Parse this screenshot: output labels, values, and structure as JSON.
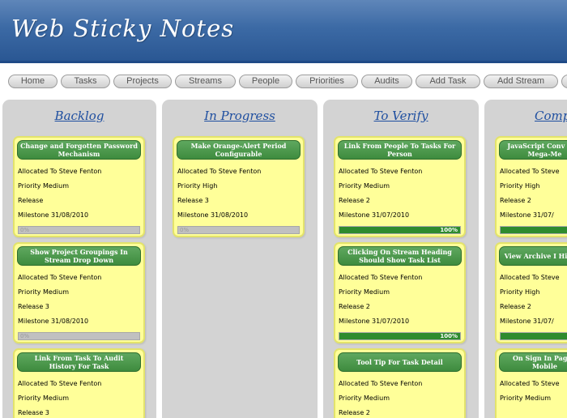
{
  "app": {
    "title": "Web Sticky Notes"
  },
  "nav": {
    "items": [
      "Home",
      "Tasks",
      "Projects",
      "Streams",
      "People",
      "Priorities",
      "Audits",
      "Add Task",
      "Add Stream",
      ""
    ]
  },
  "columns": [
    {
      "title": "Backlog",
      "notes": [
        {
          "title": "Change and Forgotten Password Mechanism",
          "allocated": "Allocated To Steve Fenton",
          "priority": "Priority Medium",
          "release": "Release",
          "milestone": "Milestone 31/08/2010",
          "progress": "0%"
        },
        {
          "title": "Show Project Groupings In Stream Drop Down",
          "allocated": "Allocated To Steve Fenton",
          "priority": "Priority Medium",
          "release": "Release 3",
          "milestone": "Milestone 31/08/2010",
          "progress": "0%"
        },
        {
          "title": "Link From Task To Audit History For Task",
          "allocated": "Allocated To Steve Fenton",
          "priority": "Priority Medium",
          "release": "Release 3",
          "milestone": "",
          "progress": ""
        }
      ]
    },
    {
      "title": "In Progress",
      "notes": [
        {
          "title": "Make Orange-Alert Period Configurable",
          "allocated": "Allocated To Steve Fenton",
          "priority": "Priority High",
          "release": "Release 3",
          "milestone": "Milestone 31/08/2010",
          "progress": "0%"
        }
      ]
    },
    {
      "title": "To Verify",
      "notes": [
        {
          "title": "Link From People To Tasks For Person",
          "allocated": "Allocated To Steve Fenton",
          "priority": "Priority Medium",
          "release": "Release 2",
          "milestone": "Milestone 31/07/2010",
          "progress": "100%"
        },
        {
          "title": "Clicking On Stream Heading Should Show Task List",
          "allocated": "Allocated To Steve Fenton",
          "priority": "Priority Medium",
          "release": "Release 2",
          "milestone": "Milestone 31/07/2010",
          "progress": "100%"
        },
        {
          "title": "Tool Tip For Task Detail",
          "allocated": "Allocated To Steve Fenton",
          "priority": "Priority Medium",
          "release": "Release 2",
          "milestone": "",
          "progress": ""
        }
      ]
    },
    {
      "title": "Comp",
      "notes": [
        {
          "title": "JavaScript Conv Into Mega-Me",
          "allocated": "Allocated To Steve",
          "priority": "Priority High",
          "release": "Release 2",
          "milestone": "Milestone 31/07/",
          "progress": ""
        },
        {
          "title": "View Archive I Hidden",
          "allocated": "Allocated To Steve",
          "priority": "Priority High",
          "release": "Release 2",
          "milestone": "Milestone 31/07/",
          "progress": ""
        },
        {
          "title": "On Sign In Page I Mobile",
          "allocated": "Allocated To Steve",
          "priority": "Priority Medium",
          "release": "",
          "milestone": "",
          "progress": ""
        }
      ]
    }
  ]
}
